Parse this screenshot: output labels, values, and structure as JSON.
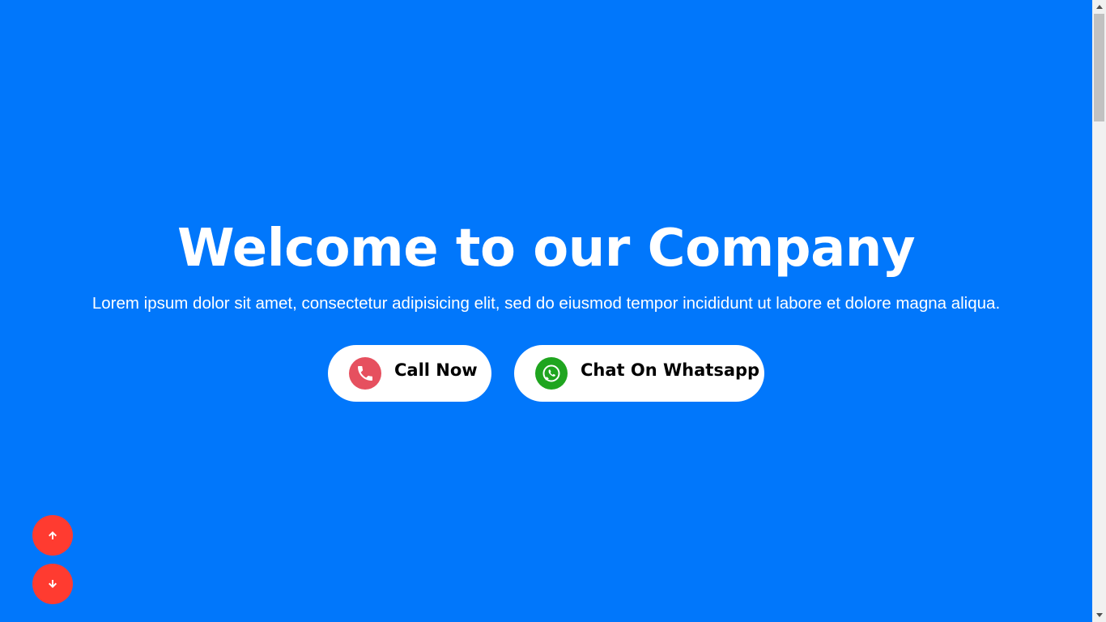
{
  "hero": {
    "title": "Welcome to our Company",
    "subtitle": "Lorem ipsum dolor sit amet, consectetur adipisicing elit, sed do eiusmod tempor incididunt ut labore et dolore magna aliqua."
  },
  "cta": {
    "call_label": "Call Now",
    "whatsapp_label": "Chat On Whatsapp"
  },
  "icons": {
    "call": "phone-icon",
    "whatsapp": "whatsapp-icon",
    "scroll_up": "arrow-up-icon",
    "scroll_down": "arrow-down-icon"
  },
  "colors": {
    "background": "#0177fb",
    "call_icon": "#e6505f",
    "whatsapp_icon": "#1fa51f",
    "scroll_buttons": "#ff3b30",
    "button_bg": "#ffffff"
  }
}
